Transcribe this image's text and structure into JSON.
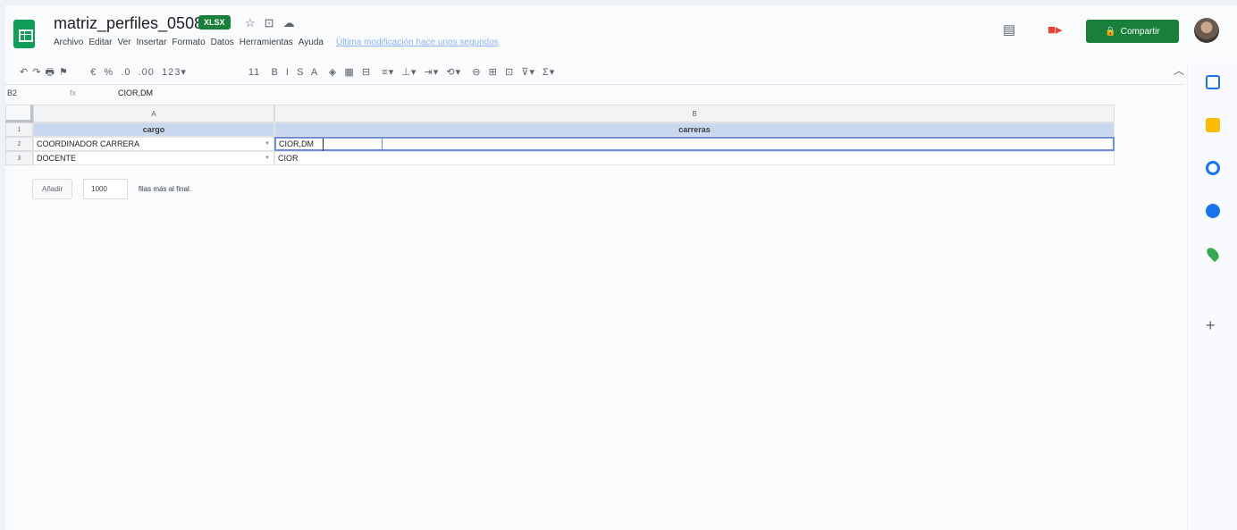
{
  "header": {
    "title": "matriz_perfiles_0508",
    "badge": "XLSX",
    "icons": [
      "star-icon",
      "folder-move-icon",
      "cloud-status-icon"
    ],
    "share_label": "Compartir",
    "menu": [
      "Archivo",
      "Editar",
      "Ver",
      "Insertar",
      "Formato",
      "Datos",
      "Herramientas",
      "Ayuda"
    ],
    "last_edit": "Última modificación hace unos segundos"
  },
  "toolbar": {
    "undo_redo_print": "↶ ↷ 🖶 ⚑",
    "format_group": "€  %  .0  .00  123▾",
    "font_size": "11",
    "text_group": "B  I  S  A   ◈  ▦  ⊟   ≡▾  ⊥▾  ⇥▾  ⟲▾   ⊖  ⊞  ⊡  ⊽▾  Σ▾"
  },
  "formula_bar": {
    "name_box": "B2",
    "fx": "fx",
    "value": "CIOR,DM"
  },
  "columns": [
    "A",
    "B"
  ],
  "rows": [
    {
      "num": "1",
      "a": "cargo",
      "b": "carreras",
      "header": true
    },
    {
      "num": "2",
      "a": "COORDINADOR CARRERA",
      "b": "CIOR,DM"
    },
    {
      "num": "3",
      "a": "DOCENTE",
      "b": "CIOR"
    }
  ],
  "add_rows": {
    "button": "Añadir",
    "count": "1000",
    "suffix": "filas más al final."
  },
  "colors": {
    "brand_green": "#188038",
    "header_fill": "#c9d7ef",
    "selection": "#6d8fd6"
  }
}
